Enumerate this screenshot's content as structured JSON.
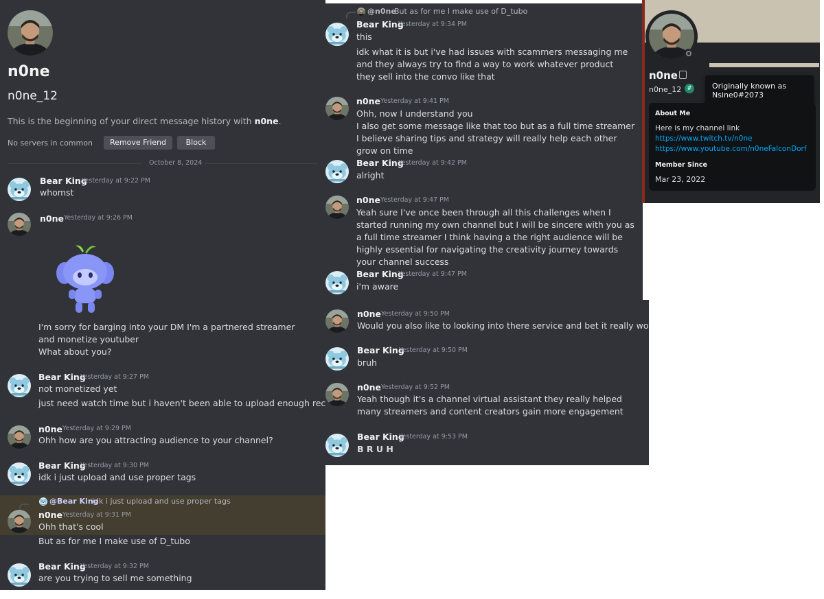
{
  "colors": {
    "background": "#313338",
    "profile_background": "#232428",
    "banner": "#c9c2b1",
    "highlight": "#433e30",
    "link": "#00a8fc",
    "bearface": "#8fc8df"
  },
  "dm_header": {
    "display_name": "n0ne",
    "username": "n0ne_12",
    "intro_prefix": "This is the beginning of your direct message history with ",
    "intro_name": "n0ne",
    "intro_suffix": ".",
    "servers": "No servers in common",
    "remove_friend": "Remove Friend",
    "block": "Block",
    "date_divider": "October 8, 2024"
  },
  "panel1": {
    "messages": [
      {
        "author": "Bear King",
        "time": "Yesterday at 9:22 PM",
        "lines": [
          "whomst"
        ]
      },
      {
        "author": "n0ne",
        "time": "Yesterday at 9:26 PM",
        "lines": [
          "I'm sorry for barging into your DM I'm a partnered streamer and monetize youtuber",
          "What about you?"
        ],
        "sticker": "wumpus-sticker"
      },
      {
        "author": "Bear King",
        "time": "Yesterday at 9:27 PM",
        "lines": [
          "not monetized yet",
          "just need watch time but i haven't been able to upload enough recently"
        ]
      },
      {
        "author": "n0ne",
        "time": "Yesterday at 9:29 PM",
        "lines": [
          "Ohh how are you attracting audience to your channel?"
        ]
      },
      {
        "author": "Bear King",
        "time": "Yesterday at 9:30 PM",
        "lines": [
          "idk i just upload and use proper tags"
        ]
      },
      {
        "author": "n0ne",
        "time": "Yesterday at 9:31 PM",
        "reply_author": "@Bear King",
        "reply_text": "idk i just upload and use proper tags",
        "lines": [
          "Ohh that's cool",
          "But as for me I make use of D_tubo"
        ]
      },
      {
        "author": "Bear King",
        "time": "Yesterday at 9:32 PM",
        "lines": [
          "are you trying to sell me something"
        ]
      }
    ]
  },
  "panel2": {
    "reply_author": "@n0ne",
    "reply_text": "But as for me I make use of D_tubo",
    "messages": [
      {
        "author": "Bear King",
        "time": "Yesterday at 9:34 PM",
        "lines": [
          "this",
          "idk what it is but i've had issues with scammers messaging me and they always try to find a way to work whatever product they sell into the convo like that"
        ]
      },
      {
        "author": "n0ne",
        "time": "Yesterday at 9:41 PM",
        "lines": [
          "Ohh, now I understand you",
          "I also get some message like that too but as a full time streamer I believe sharing tips and strategy will really help each other grow on time"
        ]
      },
      {
        "author": "Bear King",
        "time": "Yesterday at 9:42 PM",
        "lines": [
          "alright"
        ]
      },
      {
        "author": "n0ne",
        "time": "Yesterday at 9:47 PM",
        "lines": [
          "Yeah sure I've once been through all this challenges when I started running my own channel but I will be sincere with you as a full time streamer I think having a the right audience will be highly essential for navigating the creativity journey towards your channel success"
        ]
      },
      {
        "author": "Bear King",
        "time": "Yesterday at 9:47 PM",
        "lines": [
          "i'm aware"
        ]
      }
    ]
  },
  "panel3": {
    "messages": [
      {
        "author": "n0ne",
        "time": "Yesterday at 9:50 PM",
        "lines": [
          "Would you also like to looking into there service and bet it really worth it"
        ]
      },
      {
        "author": "Bear King",
        "time": "Yesterday at 9:50 PM",
        "lines": [
          "bruh"
        ]
      },
      {
        "author": "n0ne",
        "time": "Yesterday at 9:52 PM",
        "lines": [
          "Yeah though it's a channel virtual assistant they really helped many streamers and content creators gain more engagement"
        ]
      },
      {
        "author": "Bear King",
        "time": "Yesterday at 9:53 PM",
        "lines": [
          "B R U H"
        ]
      }
    ]
  },
  "profile": {
    "display_name": "n0ne",
    "username": "n0ne_12",
    "tooltip": "Originally known as Nsine0#2073",
    "about_title": "About Me",
    "about_text": "Here is my channel link",
    "link_twitch": "https://www.twitch.tv/n0ne",
    "link_youtube": "https://www.youtube.com/n0neFalconDorf",
    "member_since_title": "Member Since",
    "member_since": "Mar 23, 2022"
  }
}
